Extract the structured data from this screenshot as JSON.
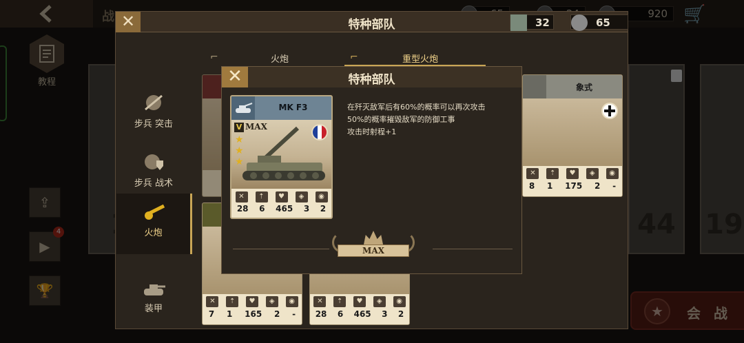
{
  "background": {
    "title": "战",
    "resources": [
      "65",
      "24",
      "920"
    ],
    "tutorial_label": "教程",
    "video_badge": "4",
    "battle_label": "会 战",
    "years": [
      "19",
      "44",
      "19"
    ],
    "right_card_name": "象式"
  },
  "dialog_main": {
    "title": "特种部队",
    "resource_tanks": "32",
    "resource_silver": "65",
    "tabs": [
      {
        "label": "火炮"
      },
      {
        "label": "重型火炮"
      }
    ],
    "categories": [
      {
        "label": "步兵 突击"
      },
      {
        "label": "步兵 战术"
      },
      {
        "label": "火炮"
      },
      {
        "label": "装甲"
      }
    ],
    "card_bottom_left": {
      "stats": [
        "7",
        "1",
        "165",
        "2",
        "-"
      ]
    },
    "card_bottom_right": {
      "stats": [
        "28",
        "6",
        "465",
        "3",
        "2"
      ]
    },
    "card_top_right": {
      "name": "象式",
      "stats": [
        "8",
        "1",
        "175",
        "2",
        "-"
      ]
    }
  },
  "dialog_detail": {
    "title": "特种部队",
    "unit": {
      "name": "MK F3",
      "rank": "V",
      "rank_label": "MAX",
      "stars": 3,
      "stats": [
        "28",
        "6",
        "465",
        "3",
        "2"
      ],
      "flag_colors": [
        "#1f3f9a",
        "#ffffff",
        "#c8202a"
      ]
    },
    "description": [
      "在歼灭敌军后有60%的概率可以再次攻击",
      "50%的概率摧毁敌军的防御工事",
      "攻击时射程+1"
    ],
    "medal_label": "MAX"
  }
}
